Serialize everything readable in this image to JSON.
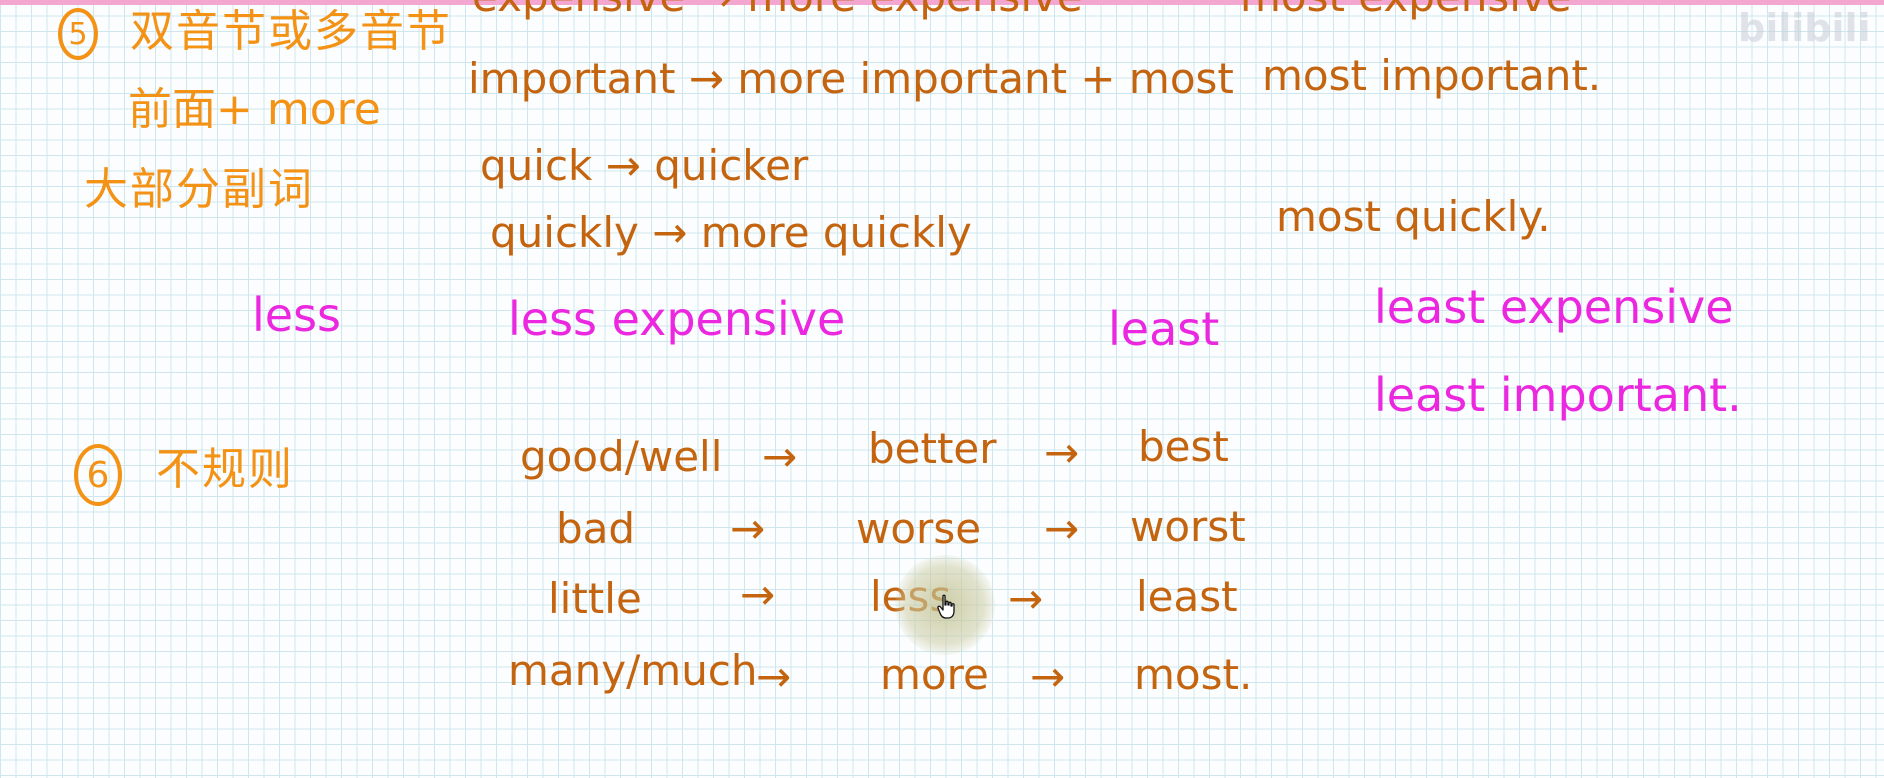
{
  "notes": {
    "section5": {
      "number": "5",
      "line1": "双音节或多音节",
      "line2": "前面+ more",
      "line3": "大部分副词"
    },
    "section6": {
      "number": "6",
      "title": "不规则"
    },
    "lines": {
      "top_cut": "expensive → more expensive",
      "top_cut_right": "most expensive",
      "important": "important → more important + most",
      "most_important": "most important.",
      "quick": "quick → quicker",
      "quickly": "quickly → more quickly",
      "most_quickly": "most quickly."
    },
    "less_row": {
      "less": "less",
      "less_expensive": "less expensive",
      "least": "least",
      "least_expensive": "least expensive",
      "least_important": "least important."
    },
    "irregular": {
      "row1": {
        "base": "good/well",
        "comparative": "better",
        "superlative": "best"
      },
      "row2": {
        "base": "bad",
        "comparative": "worse",
        "superlative": "worst"
      },
      "row3": {
        "base": "little",
        "comparative": "less",
        "superlative": "least"
      },
      "row4": {
        "base": "many/much",
        "comparative": "more",
        "superlative": "most."
      },
      "arrow": "→"
    }
  },
  "watermark": "bilibili",
  "colors": {
    "orange": "#f39214",
    "brown": "#c4640f",
    "magenta": "#ec27e0",
    "grid": "#cfe6ee"
  },
  "icons": {
    "cursor": "hand-pointer-icon"
  }
}
